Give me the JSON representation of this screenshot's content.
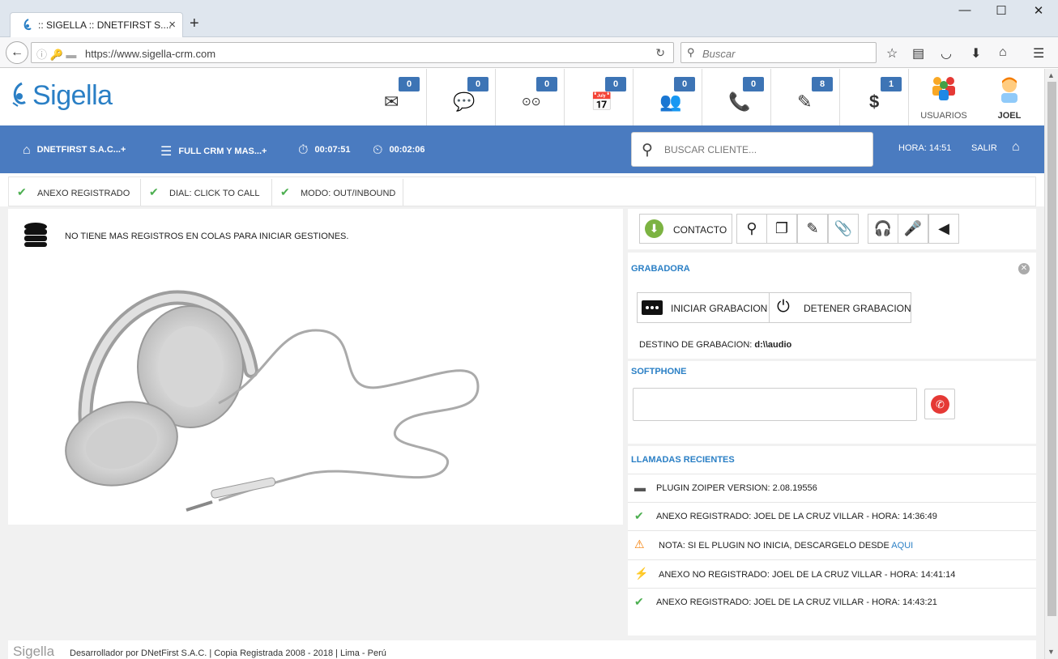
{
  "browser": {
    "tab_title": ":: SIGELLA :: DNETFIRST S....",
    "tab_close": "×",
    "new_tab": "+",
    "window_controls": [
      "—",
      "☐",
      "✕"
    ],
    "url": "https://www.sigella-crm.com",
    "search_placeholder": "Buscar"
  },
  "header": {
    "logo_text": "Sigella",
    "notifications": [
      {
        "icon": "envelope-icon",
        "glyph": "✉",
        "count": "0"
      },
      {
        "icon": "sms-icon",
        "glyph": "💬",
        "count": "0"
      },
      {
        "icon": "voicemail-icon",
        "glyph": "⊙⊙",
        "count": "0"
      },
      {
        "icon": "calendar-icon",
        "glyph": "📅",
        "count": "0"
      },
      {
        "icon": "contacts-icon",
        "glyph": "👥",
        "count": "0"
      },
      {
        "icon": "phone-icon",
        "glyph": "📞",
        "count": "0"
      },
      {
        "icon": "edit-icon",
        "glyph": "✎",
        "count": "8"
      },
      {
        "icon": "dollar-icon",
        "glyph": "$",
        "count": "1"
      }
    ],
    "users_label": "USUARIOS",
    "user_name": "JOEL"
  },
  "bluebar": {
    "company": "DNETFIRST S.A.C...+",
    "campaign": "FULL CRM Y MAS...+",
    "timer1": "00:07:51",
    "timer2": "00:02:06",
    "search_placeholder": "BUSCAR CLIENTE...",
    "time": "HORA: 14:51",
    "logout": "SALIR"
  },
  "status": [
    {
      "label": "ANEXO REGISTRADO"
    },
    {
      "label": "DIAL: CLICK TO CALL"
    },
    {
      "label": "MODO: OUT/INBOUND"
    }
  ],
  "main": {
    "queue_message": "NO TIENE MAS REGISTROS EN COLAS PARA INICIAR GESTIONES."
  },
  "toolbar": {
    "contact_label": "CONTACTO"
  },
  "recorder": {
    "title": "GRABADORA",
    "start_label": "INICIAR GRABACION",
    "stop_label": "DETENER GRABACION",
    "destination_label": "DESTINO DE GRABACION:",
    "destination_value": "d:\\\\audio"
  },
  "softphone": {
    "title": "SOFTPHONE"
  },
  "recent_calls": {
    "title": "LLAMADAS RECIENTES",
    "items": [
      {
        "icon": "plugin-icon",
        "text": "PLUGIN ZOIPER VERSION: 2.08.19556"
      },
      {
        "icon": "check-icon",
        "text": "ANEXO REGISTRADO: JOEL DE LA CRUZ VILLAR - HORA: 14:36:49"
      },
      {
        "icon": "warning-icon",
        "text": "NOTA: SI EL PLUGIN NO INICIA, DESCARGELO DESDE",
        "link": "AQUI"
      },
      {
        "icon": "unplug-icon",
        "text": "ANEXO NO REGISTRADO: JOEL DE LA CRUZ VILLAR - HORA: 14:41:14"
      },
      {
        "icon": "check-icon",
        "text": "ANEXO REGISTRADO: JOEL DE LA CRUZ VILLAR - HORA: 14:43:21"
      }
    ]
  },
  "footer": {
    "logo": "Sigella",
    "text": "Desarrollador por DNetFirst S.A.C. | Copia Registrada 2008 - 2018 | Lima - Perú"
  },
  "colors": {
    "brand_blue": "#4a7bc0",
    "logo_blue": "#2a7fc5",
    "check_green": "#4caf50",
    "call_red": "#e53935"
  }
}
